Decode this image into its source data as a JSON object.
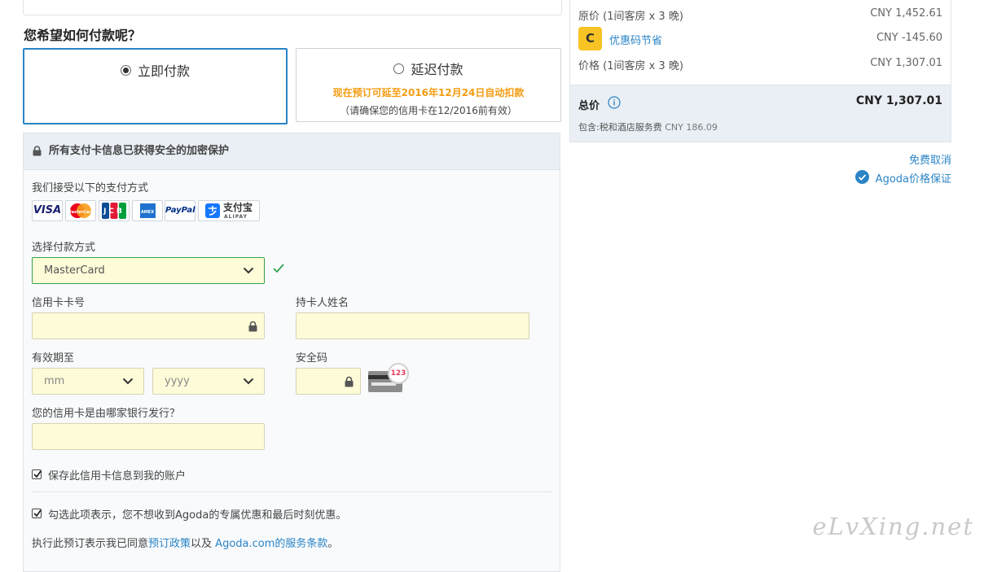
{
  "top_stub_text": "",
  "payment_title": "您希望如何付款呢？",
  "pay_now": {
    "label": "立即付款",
    "selected": true
  },
  "pay_later": {
    "label": "延迟付款",
    "note": "现在预订可延至2016年12月24日自动扣款",
    "sub": "（请确保您的信用卡在12/2016前有效）",
    "selected": false
  },
  "secure_banner": "所有支付卡信息已获得安全的加密保护",
  "accepted_label": "我们接受以下的支付方式",
  "card_logos": [
    "VISA",
    "MasterCard",
    "JCB",
    "AMEX",
    "PayPal",
    "支付宝"
  ],
  "alipay_sub": "ALIPAY",
  "method_label": "选择付款方式",
  "method_value": "MasterCard",
  "card_number_label": "信用卡卡号",
  "holder_label": "持卡人姓名",
  "expiry_label": "有效期至",
  "month_placeholder": "mm",
  "year_placeholder": "yyyy",
  "cvv_label": "安全码",
  "cvv_hint": "123",
  "bank_label": "您的信用卡是由哪家银行发行？",
  "save_card_label": "保存此信用卡信息到我的账户",
  "save_card_checked": true,
  "opt_out_label": "勾选此项表示，您不想收到Agoda的专属优惠和最后时刻优惠。",
  "opt_out_checked": true,
  "terms": {
    "prefix": "执行此预订表示我已同意",
    "policy_link": "预订政策",
    "middle": "以及 ",
    "terms_link": "Agoda.com的服务条款",
    "suffix": "。"
  },
  "summary": {
    "original_label": "原价 (1间客房 x 3 晚)",
    "original_value": "CNY 1,452.61",
    "coupon_badge": "C",
    "coupon_label": "优惠码节省",
    "coupon_value": "CNY -145.60",
    "price_label": "价格 (1间客房 x 3 晚)",
    "price_value": "CNY 1,307.01",
    "total_label": "总价",
    "total_value": "CNY 1,307.01",
    "included_prefix": "包含:",
    "included_text": "税和酒店服务费",
    "included_value": "CNY 186.09"
  },
  "free_cancel": "免费取消",
  "price_guarantee": "Agoda价格保证",
  "watermark": "eLvXing.net",
  "colors": {
    "accent_blue": "#2a84c6",
    "field_yellow": "#fefbd8",
    "valid_green": "#31a24c",
    "note_orange": "#f39c12",
    "panel_header": "#e9eff5"
  }
}
